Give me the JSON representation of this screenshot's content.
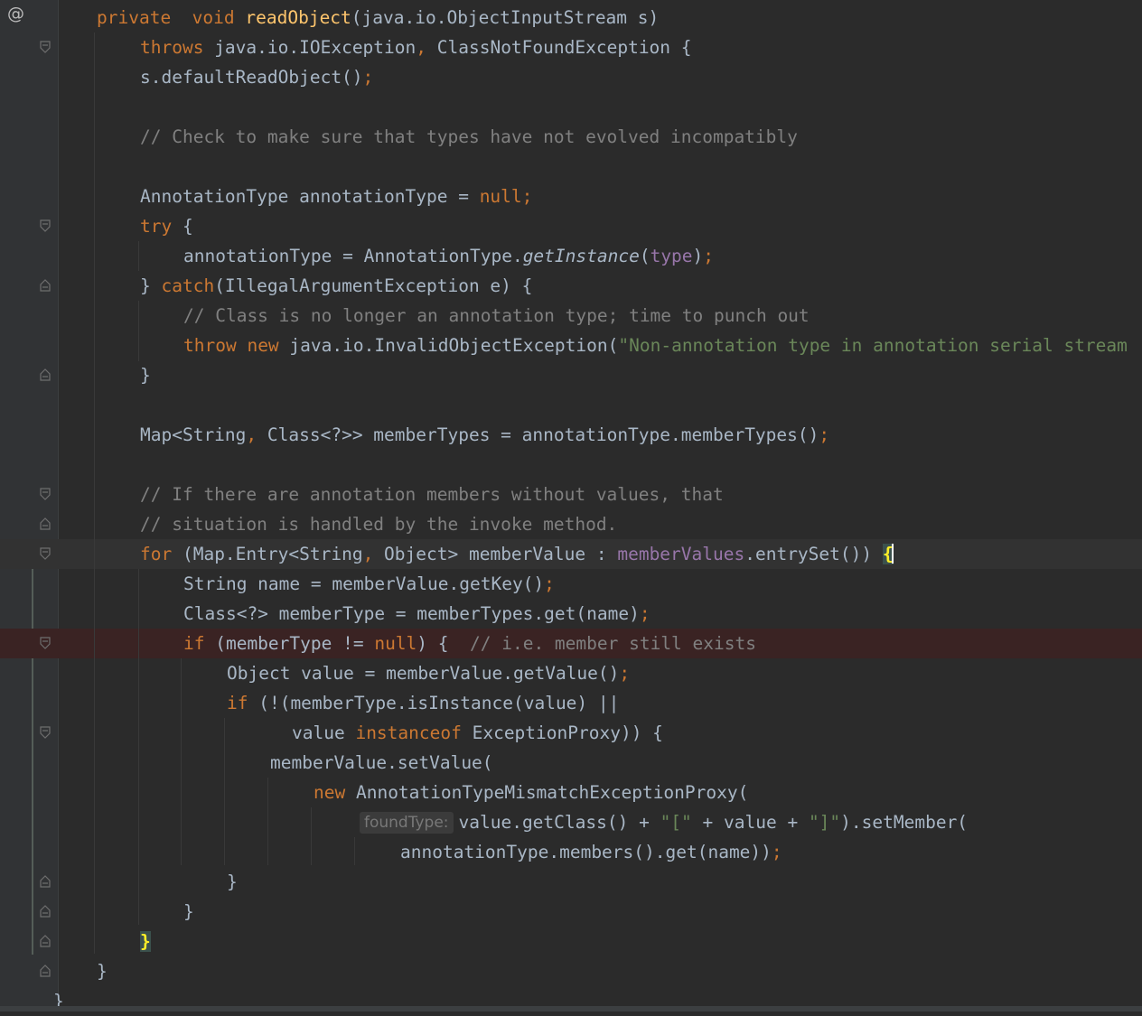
{
  "editor": {
    "gutter_at_symbol": "@",
    "lines": [
      {
        "parts": [
          [
            "kw",
            "private"
          ],
          [
            "",
            "  "
          ],
          [
            "kw",
            "void"
          ],
          [
            "",
            " "
          ],
          [
            "fn",
            "readObject"
          ],
          [
            "",
            "(java.io.ObjectInputStream s)"
          ]
        ]
      },
      {
        "parts": [
          [
            "kw",
            "throws"
          ],
          [
            "",
            " java.io.IOException"
          ],
          [
            "kw",
            ","
          ],
          [
            "",
            " ClassNotFoundException {"
          ]
        ]
      },
      {
        "parts": [
          [
            "",
            "s.defaultReadObject()"
          ],
          [
            "kw",
            ";"
          ]
        ]
      },
      {
        "parts": []
      },
      {
        "parts": [
          [
            "cm",
            "// Check to make sure that types have not evolved incompatibly"
          ]
        ]
      },
      {
        "parts": []
      },
      {
        "parts": [
          [
            "",
            "AnnotationType annotationType = "
          ],
          [
            "kw",
            "null;"
          ]
        ]
      },
      {
        "parts": [
          [
            "kw",
            "try"
          ],
          [
            "",
            " {"
          ]
        ]
      },
      {
        "parts": [
          [
            "",
            "annotationType = AnnotationType."
          ],
          [
            "it",
            "getInstance"
          ],
          [
            "",
            "("
          ],
          [
            "fld",
            "type"
          ],
          [
            "",
            ")"
          ],
          [
            "kw",
            ";"
          ]
        ]
      },
      {
        "parts": [
          [
            "",
            "} "
          ],
          [
            "kw",
            "catch"
          ],
          [
            "",
            "(IllegalArgumentException e) {"
          ]
        ]
      },
      {
        "parts": [
          [
            "cm",
            "// Class is no longer an annotation type; time to punch out"
          ]
        ]
      },
      {
        "parts": [
          [
            "kw",
            "throw"
          ],
          [
            "",
            " "
          ],
          [
            "kw",
            "new"
          ],
          [
            "",
            " java.io.InvalidObjectException("
          ],
          [
            "str",
            "\"Non-annotation type in annotation serial stream"
          ]
        ]
      },
      {
        "parts": [
          [
            "",
            "}"
          ]
        ]
      },
      {
        "parts": []
      },
      {
        "parts": [
          [
            "",
            "Map<String"
          ],
          [
            "kw",
            ","
          ],
          [
            "",
            " Class<?>> memberTypes = annotationType.memberTypes()"
          ],
          [
            "kw",
            ";"
          ]
        ]
      },
      {
        "parts": []
      },
      {
        "parts": [
          [
            "cm",
            "// If there are annotation members without values, that"
          ]
        ]
      },
      {
        "parts": [
          [
            "cm",
            "// situation is handled by the invoke method."
          ]
        ]
      },
      {
        "parts": [
          [
            "kw",
            "for"
          ],
          [
            "",
            " (Map.Entry<String"
          ],
          [
            "kw",
            ","
          ],
          [
            "",
            " Object> memberValue : "
          ],
          [
            "fld",
            "memberValues"
          ],
          [
            "",
            ".entrySet()) "
          ],
          [
            "brace",
            "{"
          ]
        ]
      },
      {
        "parts": [
          [
            "",
            "String name = memberValue.getKey()"
          ],
          [
            "kw",
            ";"
          ]
        ]
      },
      {
        "parts": [
          [
            "",
            "Class<?> memberType = memberTypes.get(name)"
          ],
          [
            "kw",
            ";"
          ]
        ]
      },
      {
        "parts": [
          [
            "kw",
            "if"
          ],
          [
            "",
            " (memberType != "
          ],
          [
            "kw",
            "null"
          ],
          [
            "",
            ") {  "
          ],
          [
            "cm",
            "// i.e. member still exists"
          ]
        ]
      },
      {
        "parts": [
          [
            "",
            "Object value = memberValue.getValue()"
          ],
          [
            "kw",
            ";"
          ]
        ]
      },
      {
        "parts": [
          [
            "kw",
            "if"
          ],
          [
            "",
            " (!(memberType.isInstance(value) ||"
          ]
        ]
      },
      {
        "parts": [
          [
            "",
            "value "
          ],
          [
            "kw",
            "instanceof"
          ],
          [
            "",
            " ExceptionProxy)) {"
          ]
        ]
      },
      {
        "parts": [
          [
            "",
            "memberValue.setValue("
          ]
        ]
      },
      {
        "parts": [
          [
            "kw",
            "new"
          ],
          [
            "",
            " AnnotationTypeMismatchExceptionProxy("
          ]
        ]
      },
      {
        "parts": [
          [
            "hint",
            "foundType:"
          ],
          [
            "",
            "value.getClass() + "
          ],
          [
            "str",
            "\"[\""
          ],
          [
            "",
            " + value + "
          ],
          [
            "str",
            "\"]\""
          ],
          [
            "",
            ").setMember("
          ]
        ]
      },
      {
        "parts": [
          [
            "",
            "annotationType.members().get(name))"
          ],
          [
            "kw",
            ";"
          ]
        ]
      },
      {
        "parts": [
          [
            "",
            "}"
          ]
        ]
      },
      {
        "parts": [
          [
            "",
            "}"
          ]
        ]
      },
      {
        "parts": [
          [
            "brace",
            "}"
          ]
        ]
      },
      {
        "parts": [
          [
            "",
            "}"
          ]
        ]
      },
      {
        "parts": [
          [
            "",
            "}"
          ]
        ]
      }
    ]
  }
}
